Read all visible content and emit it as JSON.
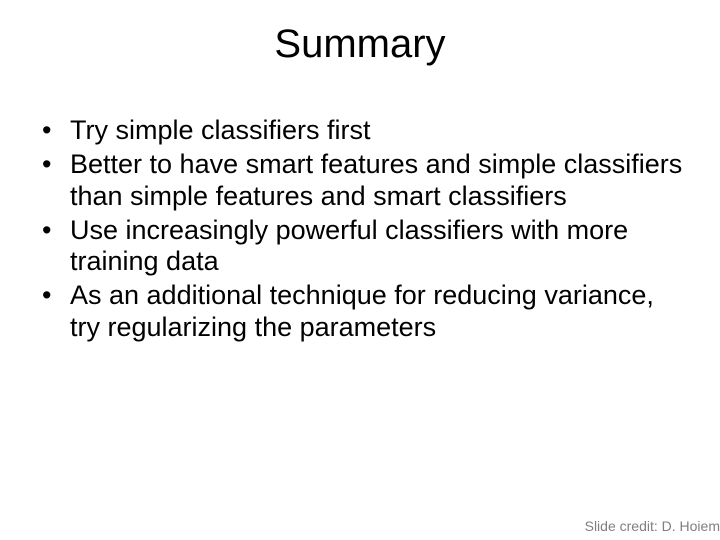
{
  "title": "Summary",
  "bullets": [
    "Try simple classifiers first",
    "Better to have smart features and simple classifiers than simple features and smart classifiers",
    "Use increasingly powerful classifiers with more training data",
    "As an additional technique for reducing variance, try regularizing the parameters"
  ],
  "credit": "Slide credit: D. Hoiem"
}
